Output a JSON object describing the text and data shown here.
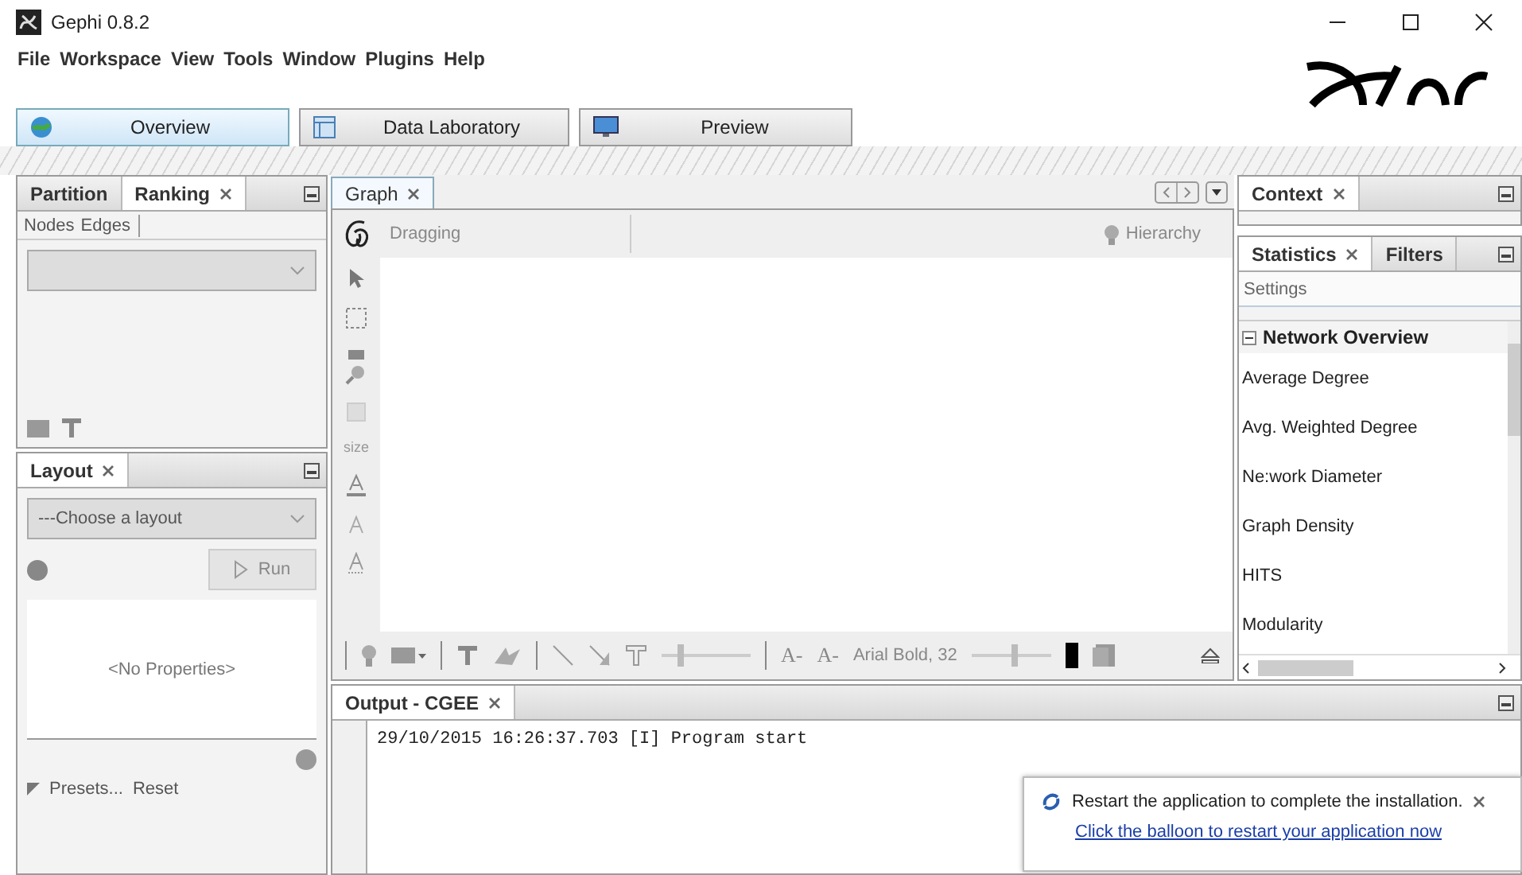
{
  "window": {
    "title": "Gephi 0.8.2"
  },
  "menu": [
    "File",
    "Workspace",
    "View",
    "Tools",
    "Window",
    "Plugins",
    "Help"
  ],
  "workspaces": [
    {
      "label": "Overview",
      "kind": "overview",
      "selected": true
    },
    {
      "label": "Data Laboratory",
      "kind": "data",
      "selected": false
    },
    {
      "label": "Preview",
      "kind": "preview",
      "selected": false
    }
  ],
  "ranking_panel": {
    "tabs": [
      {
        "label": "Partition",
        "selected": false
      },
      {
        "label": "Ranking",
        "selected": true
      }
    ],
    "subtabs": [
      {
        "label": "Nodes",
        "selected": false
      },
      {
        "label": "Edges",
        "selected": false
      }
    ]
  },
  "layout_panel": {
    "tab": "Layout",
    "select_placeholder": "---Choose a layout",
    "run": "Run",
    "properties": "<No Properties>",
    "presets": "Presets...",
    "reset": "Reset"
  },
  "graph_panel": {
    "tab": "Graph",
    "mode": "Dragging",
    "hierarchy": "Hierarchy",
    "size_tool": "size",
    "size_slider": {
      "level": 0.2
    },
    "scale_slider": {
      "level": 0.55
    },
    "font_buttons": [
      "A-",
      "A-"
    ],
    "font": "Arial Bold, 32"
  },
  "context_panel": {
    "tab": "Context"
  },
  "statistics_panel": {
    "tabs": [
      {
        "label": "Statistics",
        "selected": true
      },
      {
        "label": "Filters",
        "selected": false
      }
    ],
    "settings": "Settings",
    "section": {
      "label": "Network Overview",
      "expanded": true
    },
    "items": [
      "Average Degree",
      "Avg. Weighted Degree",
      "Ne:work Diameter",
      "Graph Density",
      "HITS",
      "Modularity"
    ]
  },
  "output_panel": {
    "tab": "Output - CGEE",
    "lines": [
      "29/10/2015 16:26:37.703 [I] Program start"
    ]
  },
  "notification": {
    "message": "Restart the application to complete the installation.",
    "link": "Click the balloon to restart your application now"
  }
}
